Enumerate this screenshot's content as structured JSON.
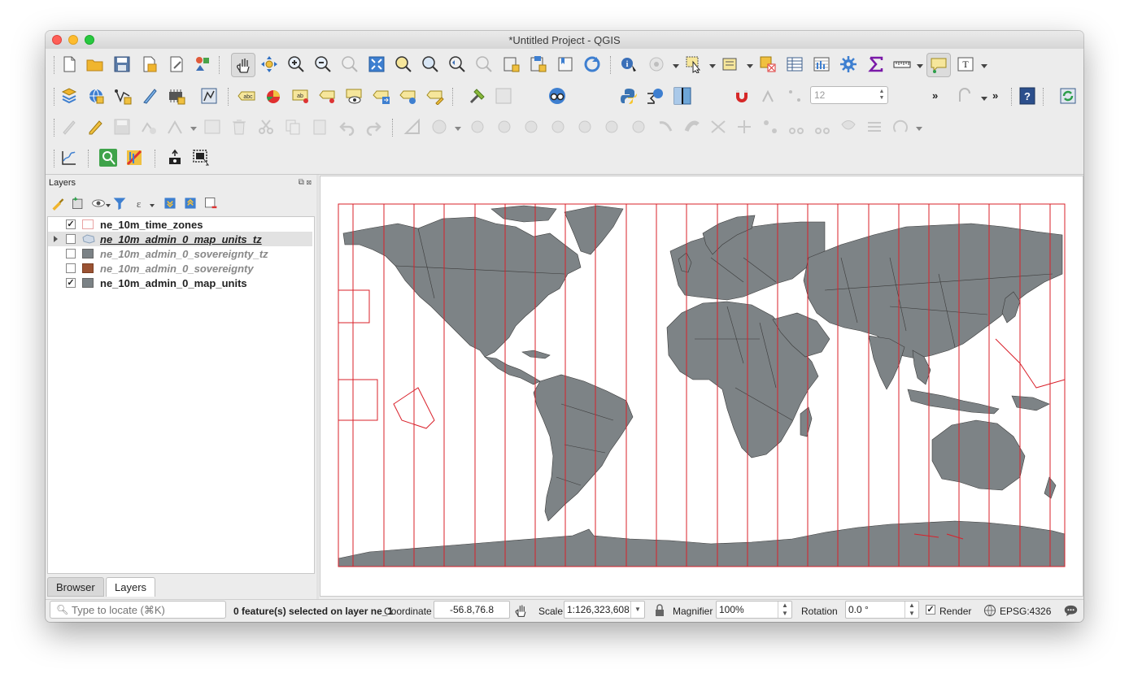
{
  "window": {
    "title": "*Untitled Project - QGIS"
  },
  "toolbar": {
    "spin_value": "12",
    "more_1": "»",
    "more_2": "»",
    "label_icon_text": "abc",
    "label_icon_text_2": "ab",
    "help_icon_text": "?",
    "label_tool_text": "T"
  },
  "layers_panel": {
    "title": "Layers",
    "layers": [
      {
        "name": "ne_10m_time_zones",
        "checked": true,
        "symbol_color": "#ffffff",
        "symbol_border": "#e9a4a4"
      },
      {
        "name": "ne_10m_admin_0_map_units_tz",
        "checked": false,
        "symbol_color": "#cfd9e6",
        "symbol_border": "#8aa0b8"
      },
      {
        "name": "ne_10m_admin_0_sovereignty_tz",
        "checked": false,
        "symbol_color": "#7b8286",
        "symbol_border": "#666666"
      },
      {
        "name": "ne_10m_admin_0_sovereignty",
        "checked": false,
        "symbol_color": "#9a5232",
        "symbol_border": "#7a3e22"
      },
      {
        "name": "ne_10m_admin_0_map_units",
        "checked": true,
        "symbol_color": "#7b8286",
        "symbol_border": "#666666"
      }
    ],
    "check_mark": "✓"
  },
  "tabs": {
    "browser": "Browser",
    "layers": "Layers"
  },
  "map": {
    "land_color": "#7d8386",
    "boundary_color": "#d9202a",
    "country_line_color": "#3b3b3b"
  },
  "status": {
    "locator_placeholder": "Type to locate (⌘K)",
    "selection_text": "0 feature(s) selected on layer ne_1",
    "coordinate_label": "Coordinate",
    "coordinate_value": "-56.8,76.8",
    "scale_label": "Scale",
    "scale_value": "1:126,323,608",
    "magnifier_label": "Magnifier",
    "magnifier_value": "100%",
    "rotation_label": "Rotation",
    "rotation_value": "0.0 °",
    "render_label": "Render",
    "render_checked": true,
    "crs": "EPSG:4326"
  }
}
